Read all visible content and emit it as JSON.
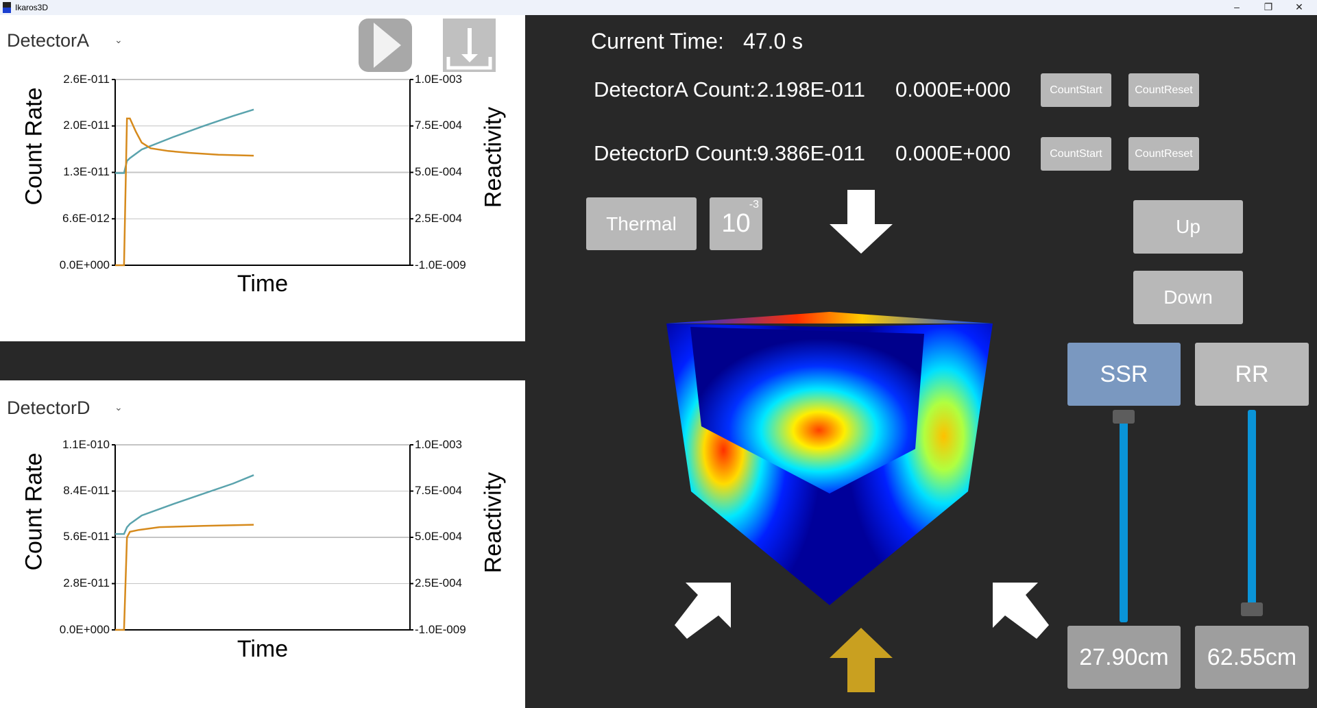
{
  "window": {
    "title": "Ikaros3D",
    "controls": [
      "–",
      "❐",
      "✕"
    ]
  },
  "top_panel": {
    "detector_select": "DetectorA",
    "play_icon": "play-icon",
    "download_icon": "download-icon"
  },
  "bottom_panel": {
    "detector_select": "DetectorD"
  },
  "status": {
    "current_time_label": "Current Time:",
    "current_time_value": "47.0 s"
  },
  "counts": [
    {
      "label": "DetectorA Count:",
      "value": "2.198E-011",
      "accum": "0.000E+000",
      "start": "CountStart",
      "reset": "CountReset"
    },
    {
      "label": "DetectorD Count:",
      "value": "9.386E-011",
      "accum": "0.000E+000",
      "start": "CountStart",
      "reset": "CountReset"
    }
  ],
  "controls": {
    "thermal": "Thermal",
    "scale_base": "10",
    "scale_exp": "-3",
    "up": "Up",
    "down": "Down",
    "rods": [
      {
        "name": "SSR",
        "value": "27.90cm",
        "slider_fraction": 1.0,
        "active": true,
        "color": "#7a98c0"
      },
      {
        "name": "RR",
        "value": "62.55cm",
        "slider_fraction": 0.03,
        "active": false,
        "color": "#b8b8b8"
      }
    ],
    "arrow_colors": {
      "white": "#ffffff",
      "highlight": "#c9a020"
    }
  },
  "chart_data": [
    {
      "type": "line",
      "xlabel": "Time",
      "ylabel": "Count Rate",
      "y2label": "Reactivity",
      "grid": true,
      "xlim": [
        0,
        100
      ],
      "ylim": [
        0,
        2.6e-11
      ],
      "y2lim": [
        0,
        0.001
      ],
      "yticks": [
        "0.0E+000",
        "6.6E-012",
        "1.3E-011",
        "2.0E-011",
        "2.6E-011"
      ],
      "y2ticks": [
        "-1.0E-009",
        "2.5E-004",
        "5.0E-004",
        "7.5E-004",
        "1.0E-003"
      ],
      "series": [
        {
          "axis": "left",
          "color": "#5aa3ad",
          "x": [
            0,
            3,
            4,
            5,
            9,
            20,
            30,
            40,
            47
          ],
          "y": [
            1.29e-11,
            1.29e-11,
            1.46e-11,
            1.5e-11,
            1.62e-11,
            1.8e-11,
            1.95e-11,
            2.09e-11,
            2.18e-11
          ]
        },
        {
          "axis": "right",
          "color": "#d68a1c",
          "x": [
            0,
            3,
            4,
            5,
            7,
            9,
            12,
            18,
            25,
            35,
            47
          ],
          "y": [
            0,
            0,
            0.00079,
            0.00079,
            0.00072,
            0.00066,
            0.00063,
            0.000615,
            0.000605,
            0.000595,
            0.00059
          ]
        }
      ]
    },
    {
      "type": "line",
      "xlabel": "Time",
      "ylabel": "Count Rate",
      "y2label": "Reactivity",
      "grid": true,
      "xlim": [
        0,
        100
      ],
      "ylim": [
        0,
        1.1e-10
      ],
      "y2lim": [
        0,
        0.001
      ],
      "yticks": [
        "0.0E+000",
        "2.8E-011",
        "5.6E-011",
        "8.4E-011",
        "1.1E-010"
      ],
      "y2ticks": [
        "-1.0E-009",
        "2.5E-004",
        "5.0E-004",
        "7.5E-004",
        "1.0E-003"
      ],
      "series": [
        {
          "axis": "left",
          "color": "#5aa3ad",
          "x": [
            0,
            3,
            4,
            5,
            9,
            20,
            30,
            40,
            47
          ],
          "y": [
            5.7e-11,
            5.7e-11,
            6.1e-11,
            6.3e-11,
            6.8e-11,
            7.5e-11,
            8.1e-11,
            8.7e-11,
            9.2e-11
          ]
        },
        {
          "axis": "right",
          "color": "#d68a1c",
          "x": [
            0,
            3,
            4,
            5,
            8,
            15,
            30,
            47
          ],
          "y": [
            0,
            0,
            0.0005,
            0.00053,
            0.00054,
            0.000555,
            0.000562,
            0.000568
          ]
        }
      ]
    }
  ]
}
